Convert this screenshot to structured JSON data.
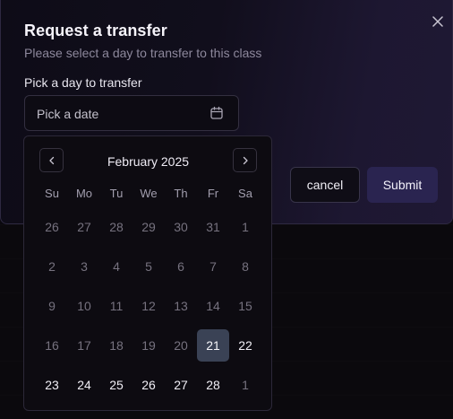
{
  "dialog": {
    "title": "Request a transfer",
    "subtitle": "Please select a day to transfer to this class",
    "close_icon": "x-icon"
  },
  "field": {
    "label": "Pick a day to transfer",
    "placeholder": "Pick a date",
    "icon": "calendar-icon"
  },
  "buttons": {
    "cancel": "cancel",
    "submit": "Submit"
  },
  "calendar": {
    "month_label": "February 2025",
    "prev_icon": "chevron-left-icon",
    "next_icon": "chevron-right-icon",
    "weekdays": [
      "Su",
      "Mo",
      "Tu",
      "We",
      "Th",
      "Fr",
      "Sa"
    ],
    "selected_day": "21",
    "weeks": [
      [
        {
          "d": "26",
          "s": "outside"
        },
        {
          "d": "27",
          "s": "outside"
        },
        {
          "d": "28",
          "s": "outside"
        },
        {
          "d": "29",
          "s": "outside"
        },
        {
          "d": "30",
          "s": "outside"
        },
        {
          "d": "31",
          "s": "outside"
        },
        {
          "d": "1",
          "s": "disabled"
        }
      ],
      [
        {
          "d": "2",
          "s": "disabled"
        },
        {
          "d": "3",
          "s": "disabled"
        },
        {
          "d": "4",
          "s": "disabled"
        },
        {
          "d": "5",
          "s": "disabled"
        },
        {
          "d": "6",
          "s": "disabled"
        },
        {
          "d": "7",
          "s": "disabled"
        },
        {
          "d": "8",
          "s": "disabled"
        }
      ],
      [
        {
          "d": "9",
          "s": "disabled"
        },
        {
          "d": "10",
          "s": "disabled"
        },
        {
          "d": "11",
          "s": "disabled"
        },
        {
          "d": "12",
          "s": "disabled"
        },
        {
          "d": "13",
          "s": "disabled"
        },
        {
          "d": "14",
          "s": "disabled"
        },
        {
          "d": "15",
          "s": "disabled"
        }
      ],
      [
        {
          "d": "16",
          "s": "disabled"
        },
        {
          "d": "17",
          "s": "disabled"
        },
        {
          "d": "18",
          "s": "disabled"
        },
        {
          "d": "19",
          "s": "disabled"
        },
        {
          "d": "20",
          "s": "disabled"
        },
        {
          "d": "21",
          "s": "selected"
        },
        {
          "d": "22",
          "s": "available"
        }
      ],
      [
        {
          "d": "23",
          "s": "available"
        },
        {
          "d": "24",
          "s": "available"
        },
        {
          "d": "25",
          "s": "available"
        },
        {
          "d": "26",
          "s": "available"
        },
        {
          "d": "27",
          "s": "available"
        },
        {
          "d": "28",
          "s": "available"
        },
        {
          "d": "1",
          "s": "outside"
        }
      ]
    ]
  },
  "colors": {
    "selected_day_bg": "#3a4255",
    "submit_bg": "#2a2450",
    "muted_text": "#76727f"
  }
}
